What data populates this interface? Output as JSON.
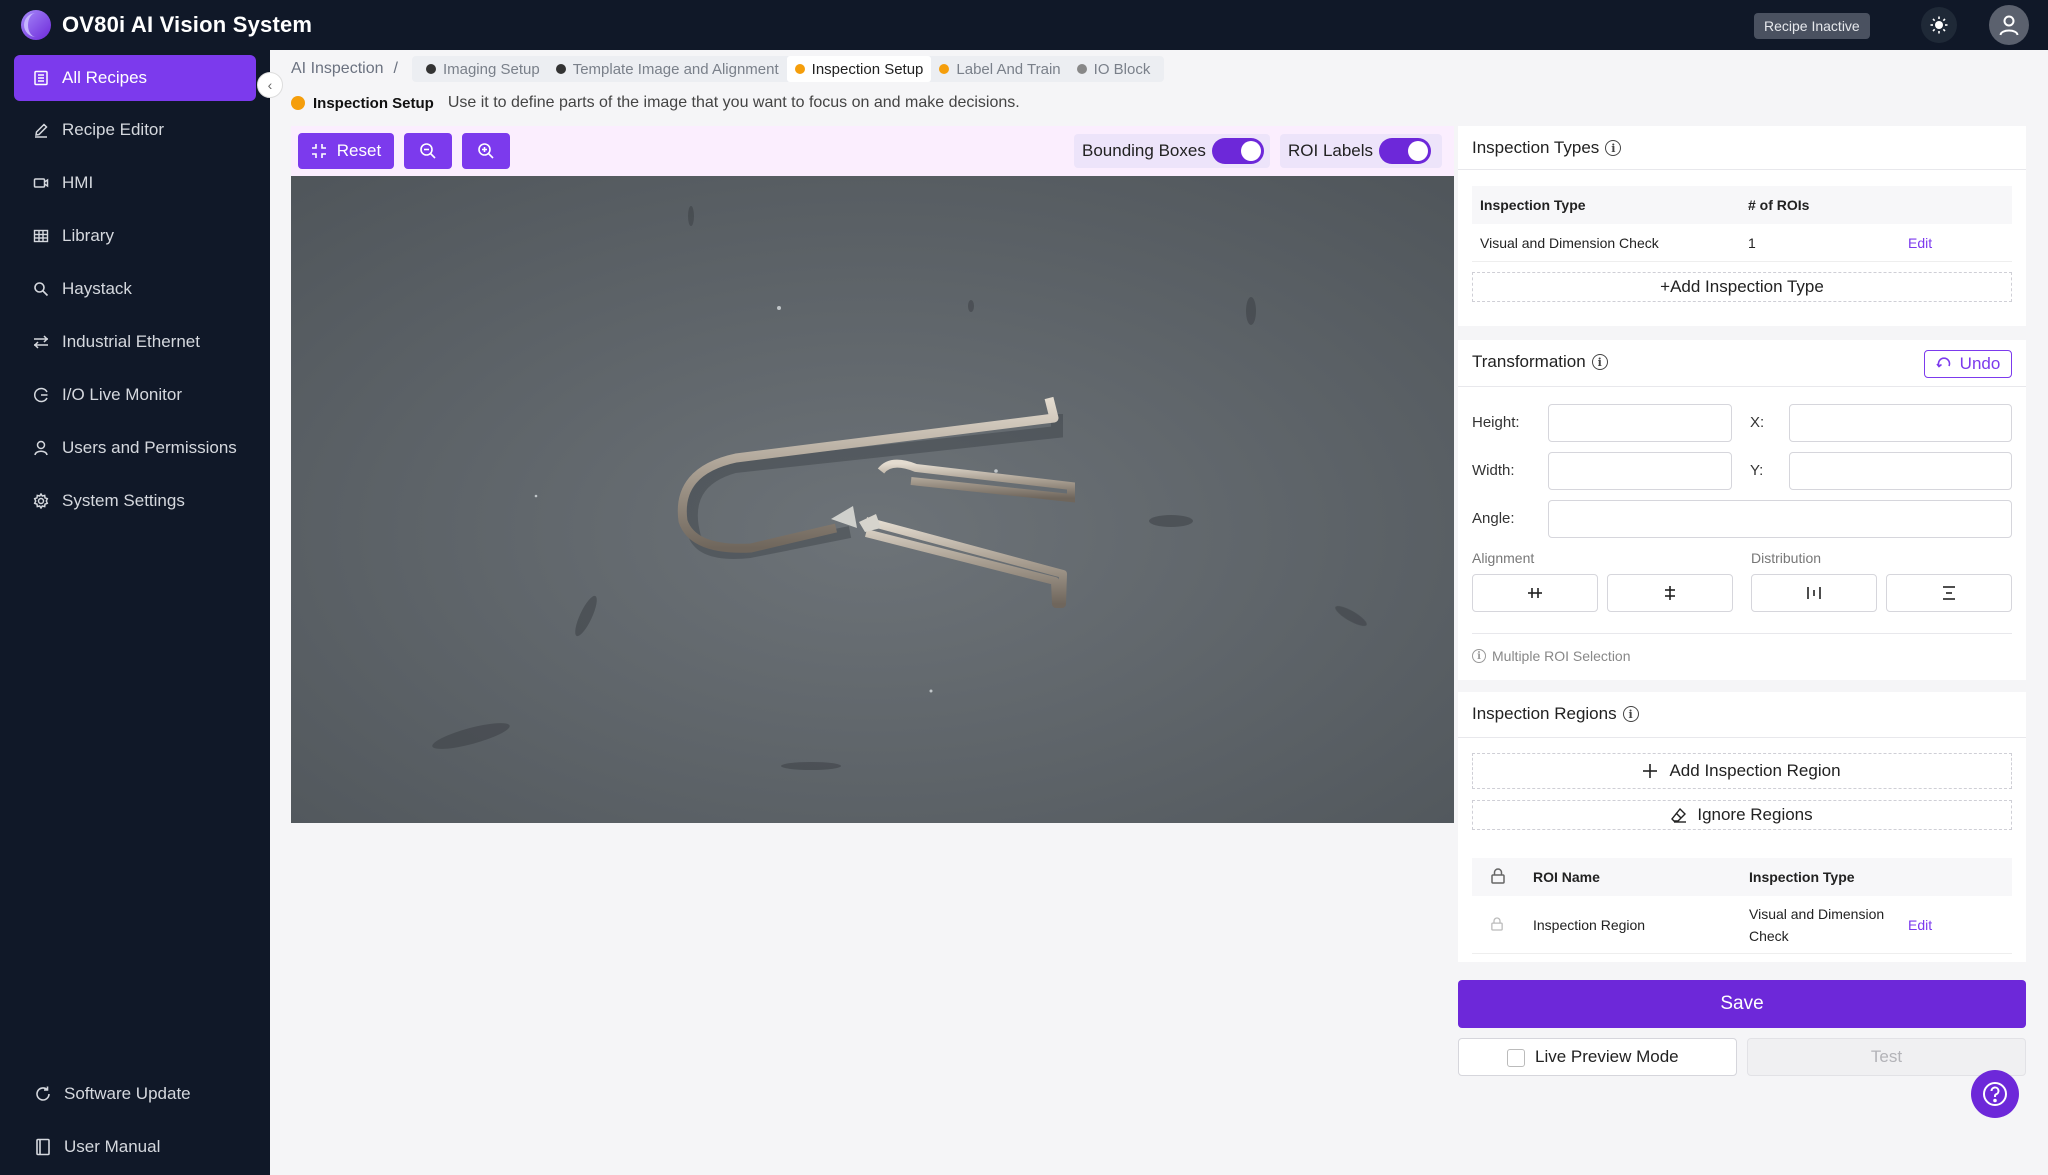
{
  "header": {
    "app_title": "OV80i AI Vision System",
    "recipe_status": "Recipe Inactive",
    "icons": {
      "logo": "app-logo",
      "theme": "sun-icon",
      "avatar": "user-icon"
    }
  },
  "sidebar": {
    "items": [
      {
        "label": "All Recipes",
        "icon": "list-icon",
        "active": true
      },
      {
        "label": "Recipe Editor",
        "icon": "pencil-icon"
      },
      {
        "label": "HMI",
        "icon": "camera-icon"
      },
      {
        "label": "Library",
        "icon": "grid-icon"
      },
      {
        "label": "Haystack",
        "icon": "search-icon"
      },
      {
        "label": "Industrial Ethernet",
        "icon": "network-icon"
      },
      {
        "label": "I/O Live Monitor",
        "icon": "monitor-icon"
      },
      {
        "label": "Users and Permissions",
        "icon": "user-icon"
      },
      {
        "label": "System Settings",
        "icon": "gear-icon"
      }
    ],
    "bottom": [
      {
        "label": "Software Update",
        "icon": "refresh-icon"
      },
      {
        "label": "User Manual",
        "icon": "book-icon"
      }
    ]
  },
  "breadcrumb": {
    "root": "AI Inspection",
    "separator": "/",
    "steps": [
      {
        "label": "Imaging Setup",
        "color": "#333333"
      },
      {
        "label": "Template Image and Alignment",
        "color": "#333333"
      },
      {
        "label": "Inspection Setup",
        "color": "#f59e0b",
        "current": true
      },
      {
        "label": "Label And Train",
        "color": "#f59e0b"
      },
      {
        "label": "IO Block",
        "color": "#888888"
      }
    ]
  },
  "description": {
    "step_name": "Inspection Setup",
    "text": "Use it to define parts of the image that you want to focus on and make decisions."
  },
  "toolbar": {
    "reset_label": "Reset",
    "bounding_boxes_label": "Bounding Boxes",
    "bounding_boxes_on": true,
    "roi_labels_label": "ROI Labels",
    "roi_labels_on": true
  },
  "inspection_types": {
    "title": "Inspection Types",
    "columns": [
      "Inspection Type",
      "# of ROIs"
    ],
    "rows": [
      {
        "type": "Visual and Dimension Check",
        "rois": "1",
        "action": "Edit"
      }
    ],
    "add_label": "+Add Inspection Type"
  },
  "transformation": {
    "title": "Transformation",
    "undo_label": "Undo",
    "height_label": "Height:",
    "x_label": "X:",
    "width_label": "Width:",
    "y_label": "Y:",
    "angle_label": "Angle:",
    "alignment_label": "Alignment",
    "distribution_label": "Distribution",
    "note": "Multiple ROI Selection"
  },
  "inspection_regions": {
    "title": "Inspection Regions",
    "add_label": "Add Inspection Region",
    "ignore_label": "Ignore Regions",
    "columns": [
      "ROI Name",
      "Inspection Type"
    ],
    "rows": [
      {
        "name": "Inspection Region",
        "type_line1": "Visual and Dimension",
        "type_line2": "Check",
        "action": "Edit"
      }
    ]
  },
  "footer": {
    "save_label": "Save",
    "live_preview_label": "Live Preview Mode",
    "test_label": "Test"
  },
  "colors": {
    "accent": "#6d28d9",
    "nav_bg": "#101828",
    "step_active": "#f59e0b"
  }
}
